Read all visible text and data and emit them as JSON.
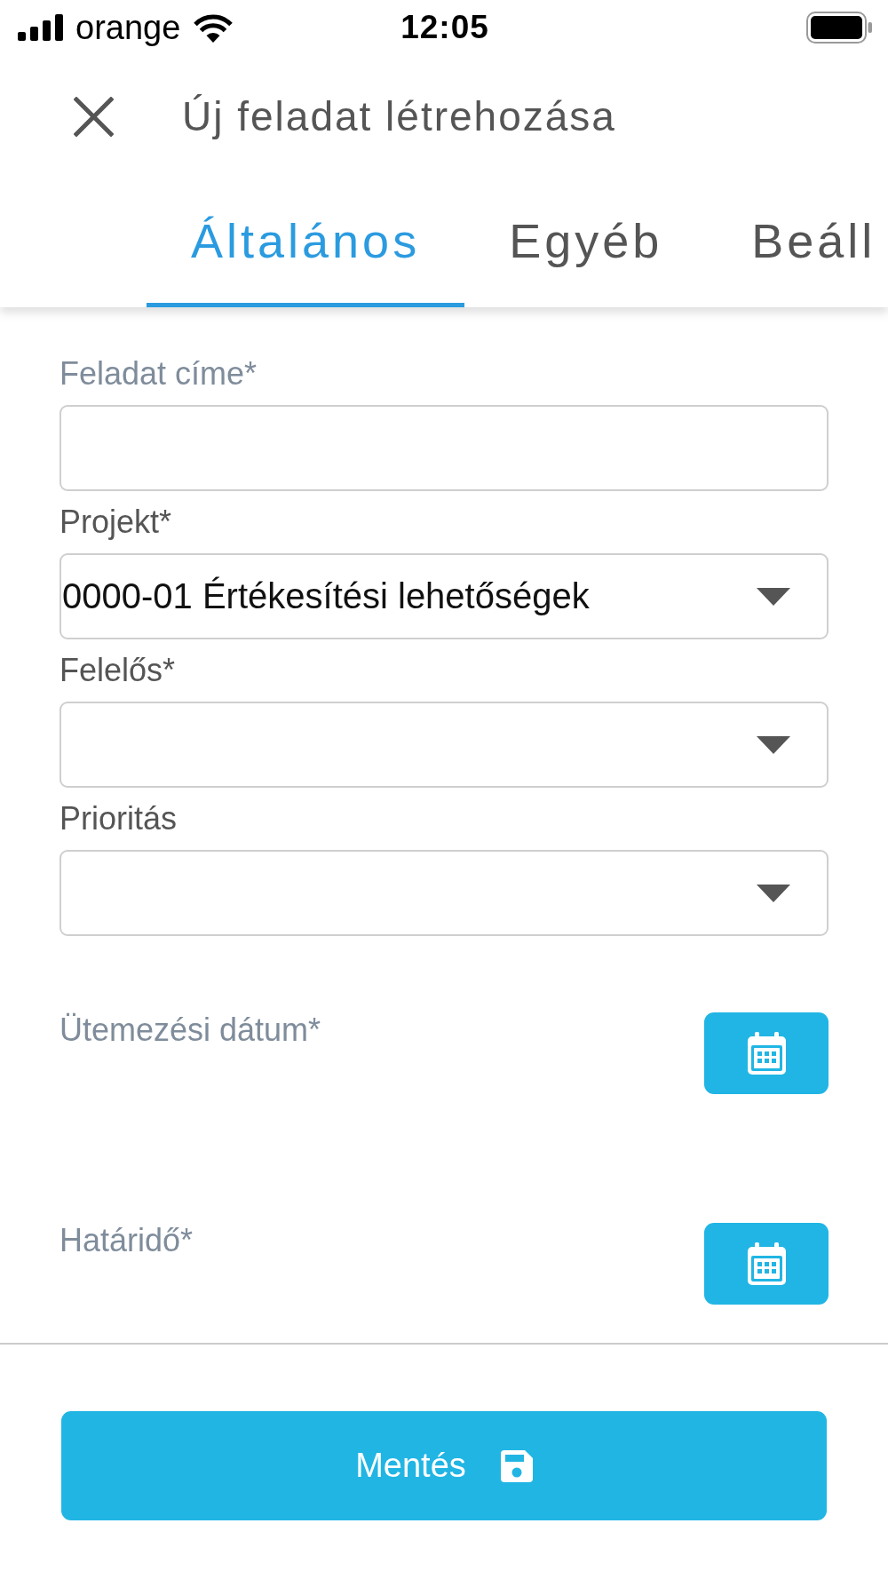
{
  "status_bar": {
    "carrier": "orange",
    "time": "12:05"
  },
  "header": {
    "title": "Új feladat létrehozása"
  },
  "tabs": [
    {
      "label": "Általános",
      "selected": true
    },
    {
      "label": "Egyéb",
      "selected": false
    },
    {
      "label": "Beáll",
      "selected": false
    }
  ],
  "fields": [
    {
      "kind": "text",
      "label": "Feladat címe*"
    },
    {
      "kind": "select",
      "label": "Projekt*",
      "value": "0000-01 Értékesítési lehetőségek"
    },
    {
      "kind": "select",
      "label": "Felelős*"
    },
    {
      "kind": "select",
      "label": "Prioritás"
    }
  ],
  "date_fields": [
    {
      "label": "Ütemezési dátum*"
    },
    {
      "label": "Határidő*"
    }
  ],
  "save_button": {
    "label": "Mentés"
  }
}
